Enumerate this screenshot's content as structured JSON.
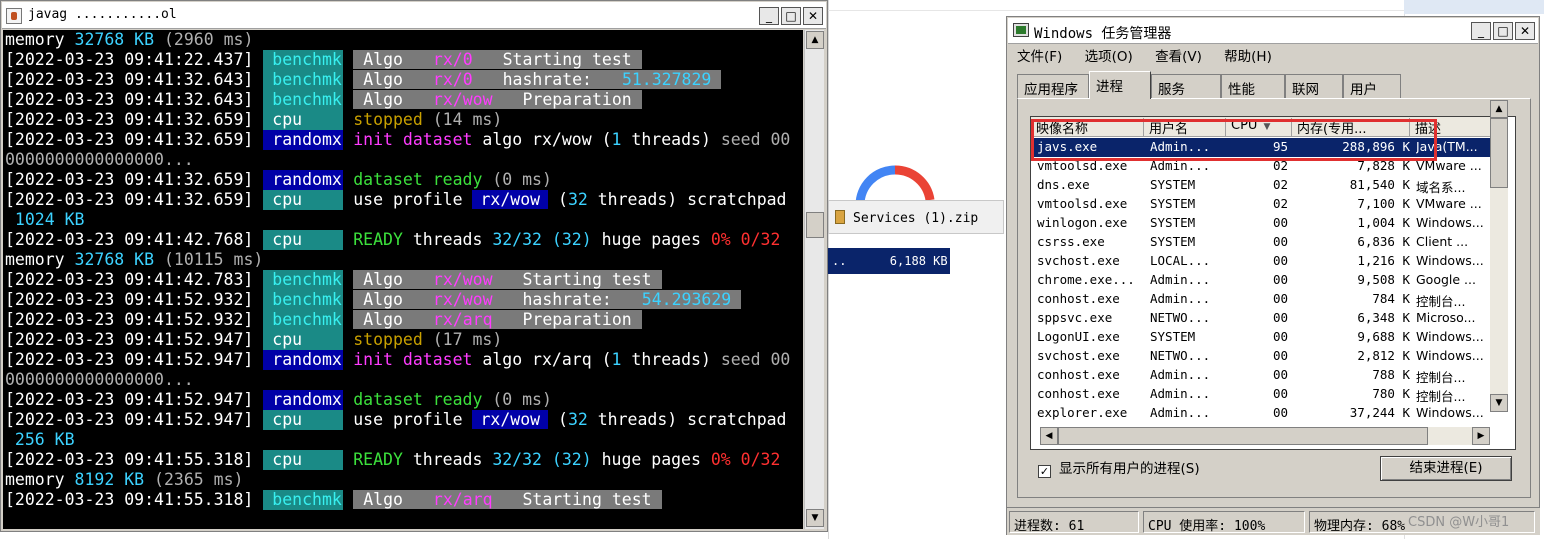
{
  "console": {
    "title": "javag ...........ol",
    "lines": [
      {
        "t": "mem",
        "a": "32768 KB",
        "b": "(2960 ms)"
      },
      {
        "t": "log",
        "ts": "[2022-03-23 09:41:22.437]",
        "tag": "benchmk",
        "tagc": "bench",
        "rest": [
          [
            "algo",
            "Algo "
          ],
          [
            "algom",
            "rx/0"
          ],
          [
            "algo",
            " Starting test"
          ]
        ]
      },
      {
        "t": "log",
        "ts": "[2022-03-23 09:41:32.643]",
        "tag": "benchmk",
        "tagc": "bench",
        "rest": [
          [
            "algo",
            "Algo "
          ],
          [
            "algom",
            "rx/0"
          ],
          [
            "algo",
            " hashrate: "
          ],
          [
            "algoc",
            "51.327829"
          ]
        ]
      },
      {
        "t": "log",
        "ts": "[2022-03-23 09:41:32.643]",
        "tag": "benchmk",
        "tagc": "bench",
        "rest": [
          [
            "algo",
            "Algo "
          ],
          [
            "algom",
            "rx/wow"
          ],
          [
            "algo",
            " Preparation"
          ]
        ]
      },
      {
        "t": "log",
        "ts": "[2022-03-23 09:41:32.659]",
        "tag": "cpu",
        "tagc": "cpu",
        "rest": [
          [
            "ylw",
            "stopped"
          ],
          [
            "gry",
            " (14 ms)"
          ]
        ]
      },
      {
        "t": "log",
        "ts": "[2022-03-23 09:41:32.659]",
        "tag": "randomx",
        "tagc": "rand",
        "rest": [
          [
            "mag",
            "init dataset"
          ],
          [
            "wht",
            " algo rx/wow ("
          ],
          [
            "cy",
            "1"
          ],
          [
            "wht",
            " threads) "
          ],
          [
            "gry",
            "seed 00"
          ]
        ]
      },
      {
        "t": "raw",
        "cls": "gry",
        "text": "0000000000000000..."
      },
      {
        "t": "log",
        "ts": "[2022-03-23 09:41:32.659]",
        "tag": "randomx",
        "tagc": "rand",
        "rest": [
          [
            "grn",
            "dataset ready"
          ],
          [
            "gry",
            " (0 ms)"
          ]
        ]
      },
      {
        "t": "log",
        "ts": "[2022-03-23 09:41:32.659]",
        "tag": "cpu",
        "tagc": "cpu",
        "rest": [
          [
            "wht",
            "use profile "
          ],
          [
            "blue",
            "rx/wow"
          ],
          [
            "wht",
            " ("
          ],
          [
            "cy",
            "32"
          ],
          [
            "wht",
            " threads) scratchpad"
          ]
        ]
      },
      {
        "t": "raw",
        "cls": "cy",
        "text": " 1024 KB"
      },
      {
        "t": "log",
        "ts": "[2022-03-23 09:41:42.768]",
        "tag": "cpu",
        "tagc": "cpu",
        "rest": [
          [
            "grn",
            "READY"
          ],
          [
            "wht",
            " threads "
          ],
          [
            "cy",
            "32/32 (32)"
          ],
          [
            "wht",
            " huge pages "
          ],
          [
            "red",
            "0% 0/32"
          ]
        ]
      },
      {
        "t": "mem",
        "a": "32768 KB",
        "b": "(10115 ms)"
      },
      {
        "t": "log",
        "ts": "[2022-03-23 09:41:42.783]",
        "tag": "benchmk",
        "tagc": "bench",
        "rest": [
          [
            "algo",
            "Algo "
          ],
          [
            "algom",
            "rx/wow"
          ],
          [
            "algo",
            " Starting test"
          ]
        ]
      },
      {
        "t": "log",
        "ts": "[2022-03-23 09:41:52.932]",
        "tag": "benchmk",
        "tagc": "bench",
        "rest": [
          [
            "algo",
            "Algo "
          ],
          [
            "algom",
            "rx/wow"
          ],
          [
            "algo",
            " hashrate: "
          ],
          [
            "algoc",
            "54.293629"
          ]
        ]
      },
      {
        "t": "log",
        "ts": "[2022-03-23 09:41:52.932]",
        "tag": "benchmk",
        "tagc": "bench",
        "rest": [
          [
            "algo",
            "Algo "
          ],
          [
            "algom",
            "rx/arq"
          ],
          [
            "algo",
            " Preparation"
          ]
        ]
      },
      {
        "t": "log",
        "ts": "[2022-03-23 09:41:52.947]",
        "tag": "cpu",
        "tagc": "cpu",
        "rest": [
          [
            "ylw",
            "stopped"
          ],
          [
            "gry",
            " (17 ms)"
          ]
        ]
      },
      {
        "t": "log",
        "ts": "[2022-03-23 09:41:52.947]",
        "tag": "randomx",
        "tagc": "rand",
        "rest": [
          [
            "mag",
            "init dataset"
          ],
          [
            "wht",
            " algo rx/arq ("
          ],
          [
            "cy",
            "1"
          ],
          [
            "wht",
            " threads) "
          ],
          [
            "gry",
            "seed 00"
          ]
        ]
      },
      {
        "t": "raw",
        "cls": "gry",
        "text": "0000000000000000..."
      },
      {
        "t": "log",
        "ts": "[2022-03-23 09:41:52.947]",
        "tag": "randomx",
        "tagc": "rand",
        "rest": [
          [
            "grn",
            "dataset ready"
          ],
          [
            "gry",
            " (0 ms)"
          ]
        ]
      },
      {
        "t": "log",
        "ts": "[2022-03-23 09:41:52.947]",
        "tag": "cpu",
        "tagc": "cpu",
        "rest": [
          [
            "wht",
            "use profile "
          ],
          [
            "blue",
            "rx/wow"
          ],
          [
            "wht",
            " ("
          ],
          [
            "cy",
            "32"
          ],
          [
            "wht",
            " threads) scratchpad"
          ]
        ]
      },
      {
        "t": "raw",
        "cls": "cy",
        "text": " 256 KB"
      },
      {
        "t": "log",
        "ts": "[2022-03-23 09:41:55.318]",
        "tag": "cpu",
        "tagc": "cpu",
        "rest": [
          [
            "grn",
            "READY"
          ],
          [
            "wht",
            " threads "
          ],
          [
            "cy",
            "32/32 (32)"
          ],
          [
            "wht",
            " huge pages "
          ],
          [
            "red",
            "0% 0/32"
          ]
        ]
      },
      {
        "t": "mem",
        "a": "8192 KB",
        "b": "(2365 ms)"
      },
      {
        "t": "log",
        "ts": "[2022-03-23 09:41:55.318]",
        "tag": "benchmk",
        "tagc": "bench",
        "rest": [
          [
            "algo",
            "Algo "
          ],
          [
            "algom",
            "rx/arq"
          ],
          [
            "algo",
            " Starting test"
          ]
        ]
      }
    ],
    "mem_label": "memory"
  },
  "background": {
    "zip_label": "Services (1).zip",
    "selected_row": "..      6,188 KB"
  },
  "taskmgr": {
    "title": "Windows 任务管理器",
    "menu": [
      "文件(F)",
      "选项(O)",
      "查看(V)",
      "帮助(H)"
    ],
    "tabs": [
      "应用程序",
      "进程",
      "服务",
      "性能",
      "联网",
      "用户"
    ],
    "active_tab": "进程",
    "columns": [
      "映像名称",
      "用户名",
      "CPU",
      "内存(专用...",
      "描述"
    ],
    "rows": [
      [
        "javs.exe",
        "Admin...",
        "95",
        "288,896 K",
        "Java(TM..."
      ],
      [
        "vmtoolsd.exe",
        "Admin...",
        "02",
        "7,828 K",
        "VMware ..."
      ],
      [
        "dns.exe",
        "SYSTEM",
        "02",
        "81,540 K",
        "域名系..."
      ],
      [
        "vmtoolsd.exe",
        "SYSTEM",
        "02",
        "7,100 K",
        "VMware ..."
      ],
      [
        "winlogon.exe",
        "SYSTEM",
        "00",
        "1,004 K",
        "Windows..."
      ],
      [
        "csrss.exe",
        "SYSTEM",
        "00",
        "6,836 K",
        "Client ..."
      ],
      [
        "svchost.exe",
        "LOCAL...",
        "00",
        "1,216 K",
        "Windows..."
      ],
      [
        "chrome.exe...",
        "Admin...",
        "00",
        "9,508 K",
        "Google ..."
      ],
      [
        "conhost.exe",
        "Admin...",
        "00",
        "784 K",
        "控制台..."
      ],
      [
        "sppsvc.exe",
        "NETWO...",
        "00",
        "6,348 K",
        "Microso..."
      ],
      [
        "LogonUI.exe",
        "SYSTEM",
        "00",
        "9,688 K",
        "Windows..."
      ],
      [
        "svchost.exe",
        "NETWO...",
        "00",
        "2,812 K",
        "Windows..."
      ],
      [
        "conhost.exe",
        "Admin...",
        "00",
        "788 K",
        "控制台..."
      ],
      [
        "conhost.exe",
        "Admin...",
        "00",
        "780 K",
        "控制台..."
      ],
      [
        "explorer.exe",
        "Admin...",
        "00",
        "37,244 K",
        "Windows..."
      ]
    ],
    "show_all_label": "显示所有用户的进程(S)",
    "show_all_checked": "✓",
    "end_process_label": "结束进程(E)",
    "status": {
      "processes": "进程数: 61",
      "cpu": "CPU 使用率: 100%",
      "memory": "物理内存: 68%"
    }
  },
  "watermark": "CSDN @W小哥1",
  "colors": {
    "console_bg": "#000000",
    "selection": "#0a246a",
    "highlight": "#e03030"
  }
}
